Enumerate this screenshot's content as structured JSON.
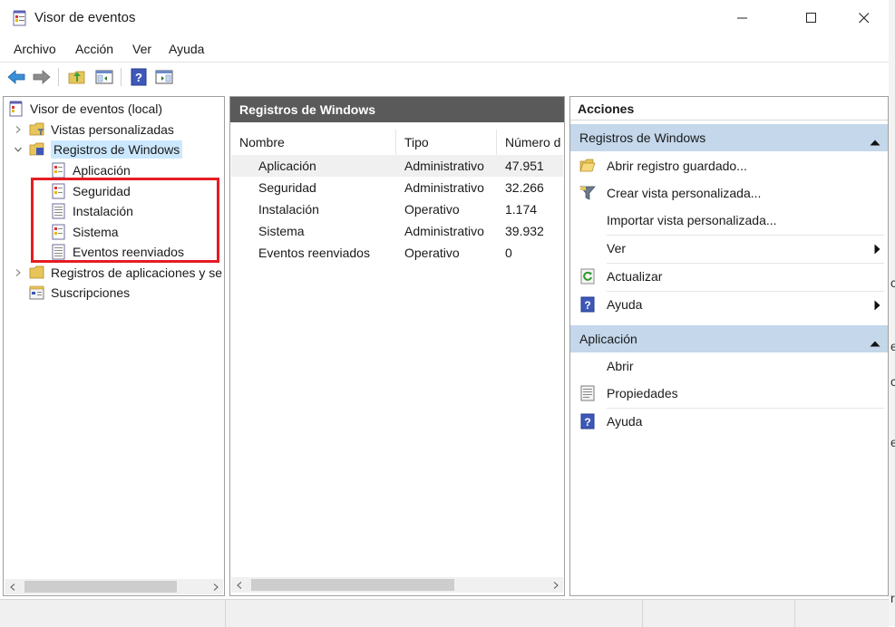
{
  "window": {
    "title": "Visor de eventos"
  },
  "menu": [
    "Archivo",
    "Acción",
    "Ver",
    "Ayuda"
  ],
  "tree": {
    "root": "Visor de eventos (local)",
    "vistas": "Vistas personalizadas",
    "registros_windows": "Registros de Windows",
    "children": [
      "Aplicación",
      "Seguridad",
      "Instalación",
      "Sistema",
      "Eventos reenviados"
    ],
    "registros_apps": "Registros de aplicaciones y se",
    "suscripciones": "Suscripciones"
  },
  "center": {
    "header": "Registros de Windows",
    "columns": [
      "Nombre",
      "Tipo",
      "Número d"
    ],
    "rows": [
      {
        "name": "Aplicación",
        "type": "Administrativo",
        "count": "47.951"
      },
      {
        "name": "Seguridad",
        "type": "Administrativo",
        "count": "32.266"
      },
      {
        "name": "Instalación",
        "type": "Operativo",
        "count": "1.174"
      },
      {
        "name": "Sistema",
        "type": "Administrativo",
        "count": "39.932"
      },
      {
        "name": "Eventos reenviados",
        "type": "Operativo",
        "count": "0"
      }
    ]
  },
  "actions": {
    "title": "Acciones",
    "section1": {
      "header": "Registros de Windows",
      "items": [
        "Abrir registro guardado...",
        "Crear vista personalizada...",
        "Importar vista personalizada...",
        "Ver",
        "Actualizar",
        "Ayuda"
      ]
    },
    "section2": {
      "header": "Aplicación",
      "items": [
        "Abrir",
        "Propiedades",
        "Ayuda"
      ]
    }
  },
  "colors": {
    "highlight_box": "#e51c23",
    "section_header": "#c4d7eb",
    "center_header": "#5a5a5a",
    "tree_selected": "#cce8ff"
  },
  "side_fragments": [
    "c",
    "e",
    "c",
    "e",
    "r"
  ]
}
